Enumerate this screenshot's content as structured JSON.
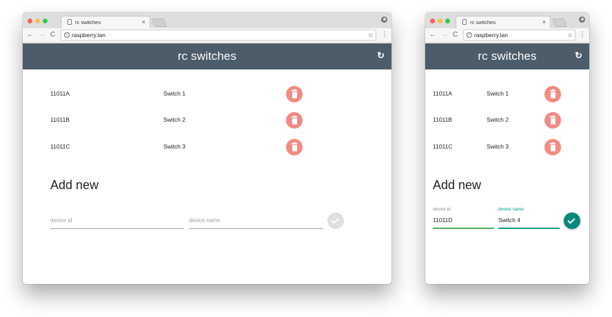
{
  "colors": {
    "appbar": "#4c5c69",
    "delete_button": "#f28b82",
    "submit_active": "#00897b",
    "accent": "#009688",
    "submit_disabled": "#e0e0e0"
  },
  "browser": {
    "tab_title": "rc switches",
    "tab_close": "×",
    "url": "raspberry.lan",
    "back": "←",
    "forward": "→",
    "reload": "C",
    "star": "☆",
    "menu": "⋮",
    "info": "i"
  },
  "app": {
    "title": "rc switches",
    "refresh_icon": "↻",
    "section_title": "Add new"
  },
  "large": {
    "switches": [
      {
        "id": "11011A",
        "name": "Switch 1"
      },
      {
        "id": "11011B",
        "name": "Switch 2"
      },
      {
        "id": "11011C",
        "name": "Switch 3"
      }
    ],
    "form": {
      "device_id_placeholder": "device id",
      "device_name_placeholder": "device name"
    }
  },
  "small": {
    "switches": [
      {
        "id": "11011A",
        "name": "Switch 1"
      },
      {
        "id": "11011B",
        "name": "Switch 2"
      },
      {
        "id": "11011C",
        "name": "Switch 3"
      }
    ],
    "form": {
      "device_id_label": "device id",
      "device_id_value": "11011D",
      "device_name_label": "device name",
      "device_name_value": "Switch 4"
    }
  }
}
